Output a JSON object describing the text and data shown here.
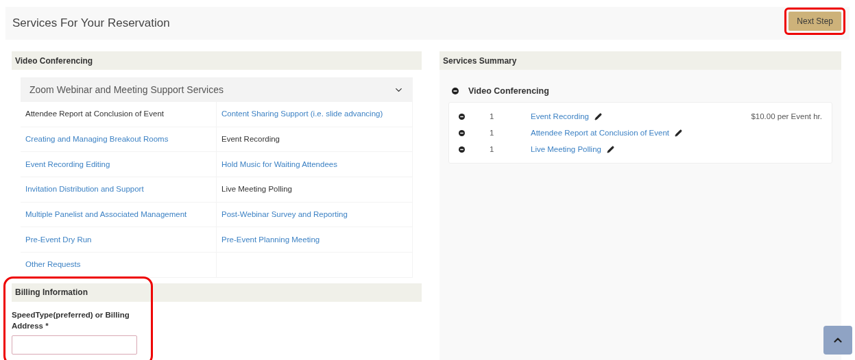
{
  "header": {
    "title": "Services For Your Reservation",
    "next_button": {
      "label": "Next Step",
      "highlighted": true
    }
  },
  "video_section": {
    "title": "Video Conferencing",
    "accordion": {
      "title": "Zoom Webinar and Meeting Support Services",
      "expanded": true
    },
    "services": [
      {
        "label": "Attendee Report at Conclusion of Event",
        "selected": true
      },
      {
        "label": "Content Sharing Support (i.e. slide advancing)",
        "selected": false
      },
      {
        "label": "Creating and Managing Breakout Rooms",
        "selected": false
      },
      {
        "label": "Event Recording",
        "selected": true
      },
      {
        "label": "Event Recording Editing",
        "selected": false
      },
      {
        "label": "Hold Music for Waiting Attendees",
        "selected": false
      },
      {
        "label": "Invitation Distribution and Support",
        "selected": false
      },
      {
        "label": "Live Meeting Polling",
        "selected": true
      },
      {
        "label": "Multiple Panelist and Associated Management",
        "selected": false
      },
      {
        "label": "Post-Webinar Survey and Reporting",
        "selected": false
      },
      {
        "label": "Pre-Event Dry Run",
        "selected": false
      },
      {
        "label": "Pre-Event Planning Meeting",
        "selected": false
      },
      {
        "label": "Other Requests",
        "selected": false
      }
    ]
  },
  "billing": {
    "title": "Billing Information",
    "highlighted": true,
    "field_label": "SpeedType(preferred) or Billing Address *"
  },
  "summary": {
    "title": "Services Summary",
    "group": "Video Conferencing",
    "items": [
      {
        "quantity": "1",
        "name": "Event Recording",
        "price": "$10.00 per Event hr."
      },
      {
        "quantity": "1",
        "name": "Attendee Report at Conclusion of Event"
      },
      {
        "quantity": "1",
        "name": "Live Meeting Polling"
      }
    ]
  }
}
